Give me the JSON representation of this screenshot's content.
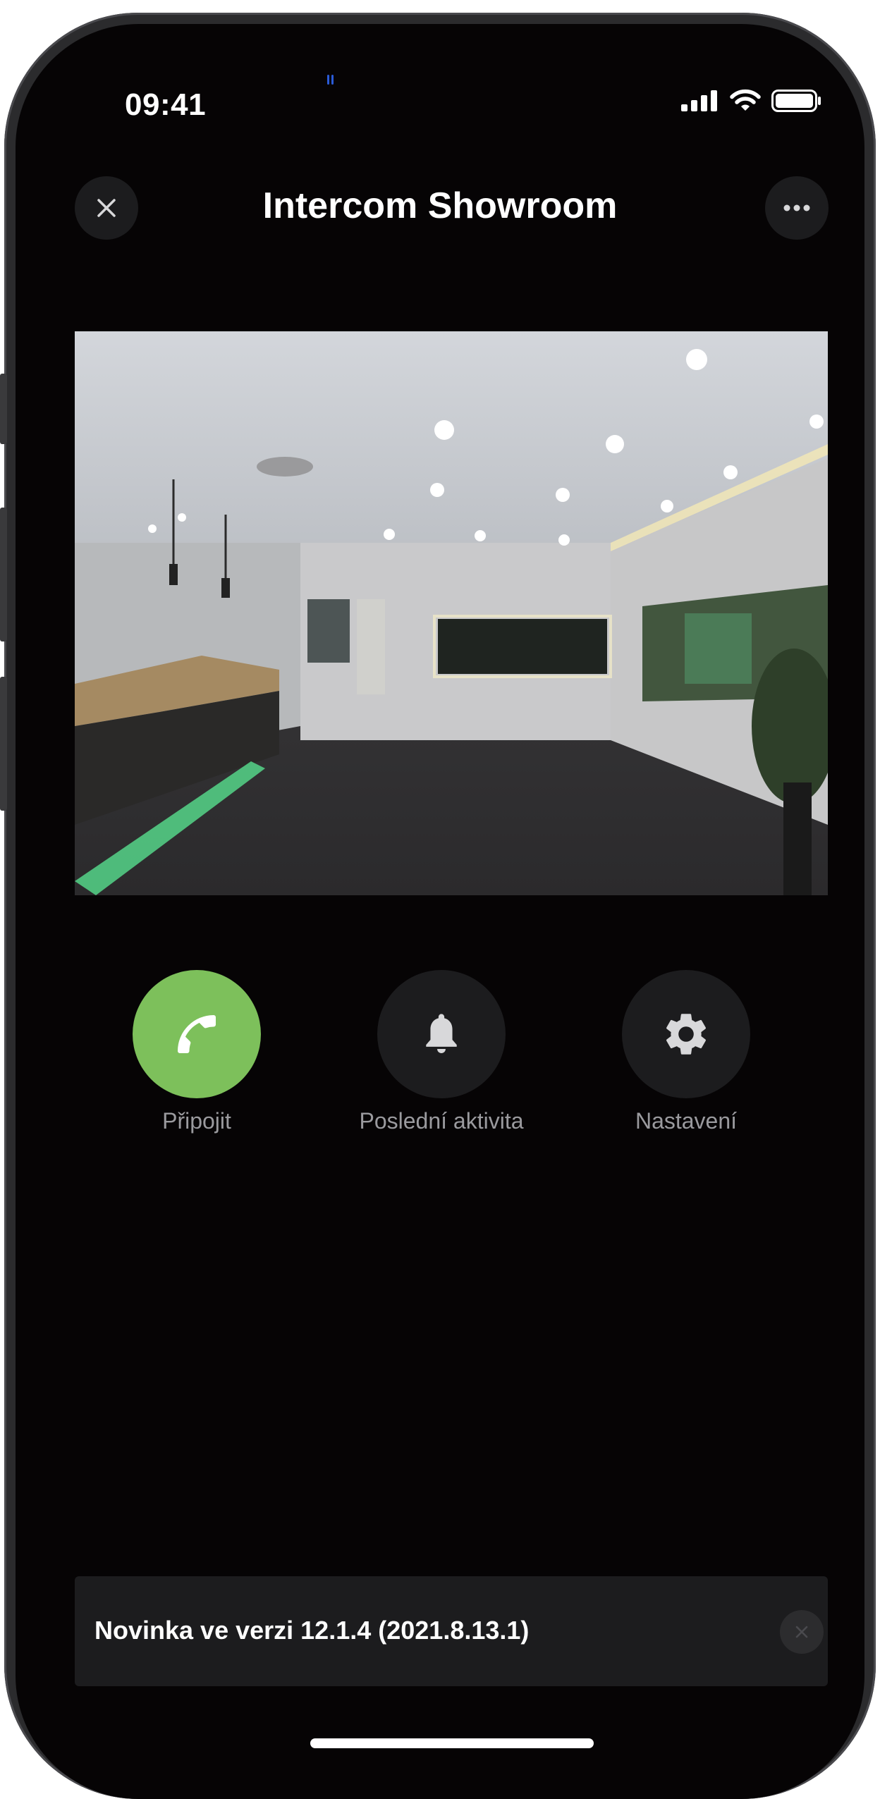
{
  "status_bar": {
    "time": "09:41",
    "icons": [
      "cellular-signal-icon",
      "wifi-icon",
      "battery-icon"
    ]
  },
  "header": {
    "title": "Intercom Showroom",
    "close_icon": "close-icon",
    "more_icon": "more-horizontal-icon"
  },
  "camera": {
    "description_name": "live-camera-feed"
  },
  "actions": [
    {
      "label": "Připojit",
      "icon": "phone-icon",
      "color": "#7dc05b"
    },
    {
      "label": "Poslední aktivita",
      "icon": "bell-icon",
      "color": "#1c1c1e"
    },
    {
      "label": "Nastavení",
      "icon": "gear-icon",
      "color": "#1c1c1e"
    }
  ],
  "notice": {
    "text": "Novinka ve verzi 12.1.4 (2021.8.13.1)",
    "close_icon": "close-icon"
  },
  "colors": {
    "background": "#060405",
    "accent_green": "#7dc05b",
    "button_dark": "#1c1c1e",
    "label_gray": "#9a9a9e"
  }
}
